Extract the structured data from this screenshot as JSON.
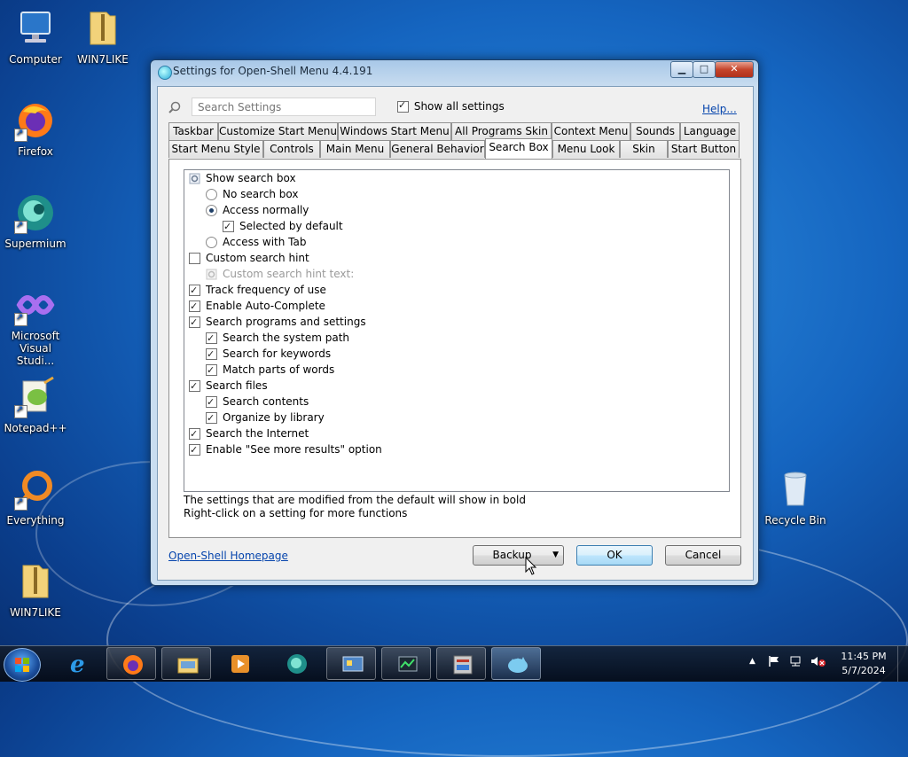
{
  "desktop": {
    "icons": [
      {
        "label": "Computer"
      },
      {
        "label": "WIN7LIKE"
      },
      {
        "label": "Firefox"
      },
      {
        "label": "Supermium"
      },
      {
        "label": "Microsoft Visual Studi..."
      },
      {
        "label": "Notepad++"
      },
      {
        "label": "Everything"
      },
      {
        "label": "WIN7LIKE"
      },
      {
        "label": "Recycle Bin"
      }
    ]
  },
  "window": {
    "title": "Settings for Open-Shell Menu 4.4.191",
    "controls": {
      "minimize": "▁",
      "maximize": "□",
      "close": "✕"
    },
    "search": {
      "placeholder": "Search Settings",
      "value": ""
    },
    "show_all_label": "Show all settings",
    "show_all_checked": true,
    "help_label": "Help...",
    "tabs_row1": [
      "Taskbar",
      "Customize Start Menu",
      "Windows Start Menu",
      "All Programs Skin",
      "Context Menu",
      "Sounds",
      "Language"
    ],
    "tabs_row2": [
      "Start Menu Style",
      "Controls",
      "Main Menu",
      "General Behavior",
      "Search Box",
      "Menu Look",
      "Skin",
      "Start Button"
    ],
    "active_tab": "Search Box",
    "settings": [
      {
        "label": "Show search box",
        "control": "gear",
        "level": 0
      },
      {
        "label": "No search box",
        "control": "radio",
        "checked": false,
        "level": 1
      },
      {
        "label": "Access normally",
        "control": "radio",
        "checked": true,
        "level": 1
      },
      {
        "label": "Selected by default",
        "control": "checkbox",
        "checked": true,
        "level": 2
      },
      {
        "label": "Access with Tab",
        "control": "radio",
        "checked": false,
        "level": 1
      },
      {
        "label": "Custom search hint",
        "control": "checkbox",
        "checked": false,
        "level": 0
      },
      {
        "label": "Custom search hint text:",
        "control": "gear-disabled",
        "level": 1,
        "disabled": true
      },
      {
        "label": "Track frequency of use",
        "control": "checkbox",
        "checked": true,
        "level": 0
      },
      {
        "label": "Enable Auto-Complete",
        "control": "checkbox",
        "checked": true,
        "level": 0
      },
      {
        "label": "Search programs and settings",
        "control": "checkbox",
        "checked": true,
        "level": 0
      },
      {
        "label": "Search the system path",
        "control": "checkbox",
        "checked": true,
        "level": 1
      },
      {
        "label": "Search for keywords",
        "control": "checkbox",
        "checked": true,
        "level": 1
      },
      {
        "label": "Match parts of words",
        "control": "checkbox",
        "checked": true,
        "level": 1
      },
      {
        "label": "Search files",
        "control": "checkbox",
        "checked": true,
        "level": 0
      },
      {
        "label": "Search contents",
        "control": "checkbox",
        "checked": true,
        "level": 1
      },
      {
        "label": "Organize by library",
        "control": "checkbox",
        "checked": true,
        "level": 1
      },
      {
        "label": "Search the Internet",
        "control": "checkbox",
        "checked": true,
        "level": 0
      },
      {
        "label": "Enable \"See more results\" option",
        "control": "checkbox",
        "checked": true,
        "level": 0
      }
    ],
    "note_line1": "The settings that are modified from the default will show in bold",
    "note_line2": "Right-click on a setting for more functions",
    "homepage_link": "Open-Shell Homepage",
    "backup_label": "Backup",
    "ok_label": "OK",
    "cancel_label": "Cancel"
  },
  "taskbar": {
    "clock_time": "11:45 PM",
    "clock_date": "5/7/2024"
  }
}
